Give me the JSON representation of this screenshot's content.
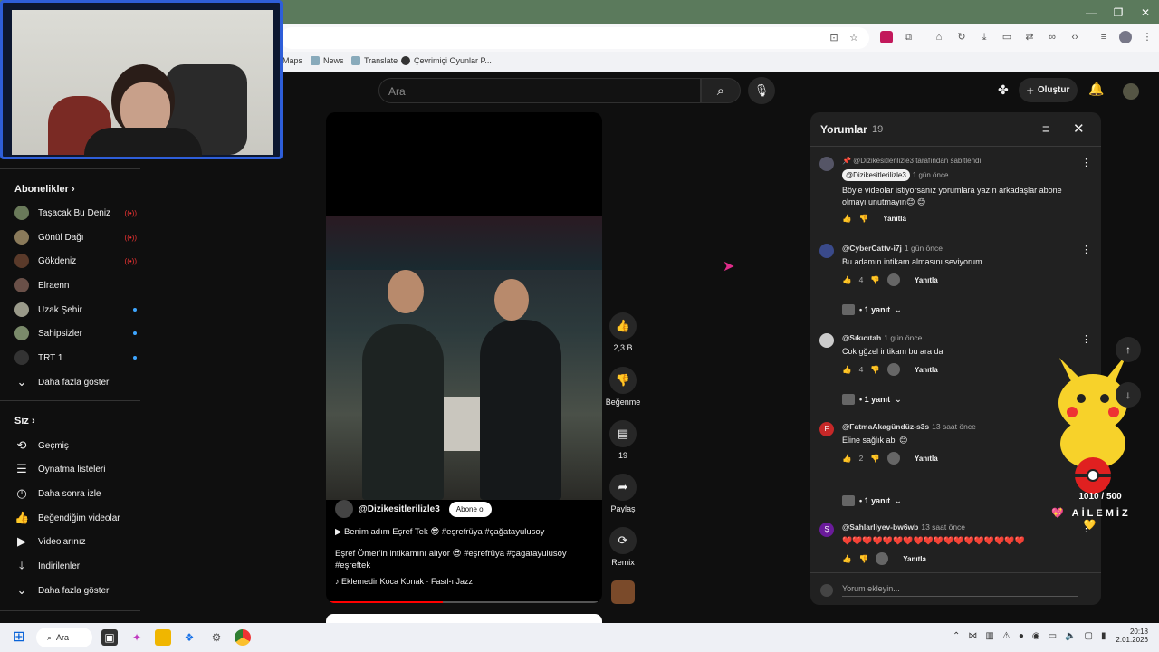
{
  "browser": {
    "bookmarks": [
      "Maps",
      "News",
      "Translate",
      "Çevrimiçi Oyunlar P..."
    ]
  },
  "header": {
    "search_placeholder": "Ara",
    "create_label": "Oluştur"
  },
  "sidebar": {
    "subscriptions_title": "Abonelikler",
    "subscriptions": [
      {
        "label": "Taşacak Bu Deniz",
        "badge": "live"
      },
      {
        "label": "Gönül Dağı",
        "badge": "live"
      },
      {
        "label": "Gökdeniz",
        "badge": "live"
      },
      {
        "label": "Elraenn",
        "badge": ""
      },
      {
        "label": "Uzak Şehir",
        "badge": "dot"
      },
      {
        "label": "Sahipsizler",
        "badge": "dot"
      },
      {
        "label": "TRT 1",
        "badge": "dot"
      }
    ],
    "show_more": "Daha fazla göster",
    "you_title": "Siz",
    "you_items": [
      {
        "label": "Geçmiş",
        "icon": "history-icon",
        "glyph": "⟲"
      },
      {
        "label": "Oynatma listeleri",
        "icon": "playlist-icon",
        "glyph": "☰"
      },
      {
        "label": "Daha sonra izle",
        "icon": "clock-icon",
        "glyph": "◷"
      },
      {
        "label": "Beğendiğim videolar",
        "icon": "thumb-up-icon",
        "glyph": "👍"
      },
      {
        "label": "Videolarınız",
        "icon": "video-icon",
        "glyph": "▶"
      },
      {
        "label": "İndirilenler",
        "icon": "download-icon",
        "glyph": "⤓"
      }
    ],
    "show_more_2": "Daha fazla göster"
  },
  "video": {
    "channel": "@Dizikesitlerilizle3",
    "subscribe_label": "Abone ol",
    "line1": "▶  Benim adım Eşref Tek 😎   #eşrefrüya #çağatayulusoy",
    "line2": "Eşref Ömer'in intikamını alıyor 😎 #eşrefrüya #çagatayulusoy #eşreftek",
    "music": "♪ Eklemedir Koca Konak · Fasıl-ı Jazz",
    "progress": 0.42
  },
  "actions": {
    "like_count": "2,3 B",
    "dislike_label": "Beğenme",
    "comment_count": "19",
    "share_label": "Paylaş",
    "remix_label": "Remix"
  },
  "comments": {
    "title": "Yorumlar",
    "count": "19",
    "items": [
      {
        "pinned": "📌 @Dizikesitlerilizle3 tarafından sabitlendi",
        "author": "@Dizikesitlerilizle3",
        "time": "1 gün önce",
        "text": "Böyle videolar istiyorsanız yorumlara yazın arkadaşlar abone olmayı unutmayın😊 😊",
        "likes": "",
        "reply_label": "Yanıtla"
      },
      {
        "author": "@CyberCattv-i7j",
        "time": "1 gün önce",
        "text": "Bu adamın intikam almasını seviyorum",
        "likes": "4",
        "reply_label": "Yanıtla",
        "replies": "• 1 yanıt"
      },
      {
        "author": "@Sıkıcıtah",
        "time": "1 gün önce",
        "text": "Cok gğzel intikam bu ara da",
        "likes": "4",
        "reply_label": "Yanıtla",
        "replies": "• 1 yanıt"
      },
      {
        "author": "@FatmaAkagündüz-s3s",
        "time": "13 saat önce",
        "text": "Eline sağlık abi 😊",
        "likes": "2",
        "reply_label": "Yanıtla",
        "replies": "• 1 yanıt",
        "avatar_letter": "F"
      },
      {
        "author": "@Sahlarliyev-bw6wb",
        "time": "13 saat önce",
        "text": "❤️❤️❤️❤️❤️❤️❤️❤️❤️❤️❤️❤️❤️❤️❤️❤️❤️❤️",
        "likes": "",
        "reply_label": "Yanıtla",
        "avatar_letter": "Ş"
      }
    ],
    "input_placeholder": "Yorum ekleyin..."
  },
  "overlay": {
    "counter": "1010 / 500",
    "family": "💖 AİLEMİZ 💛"
  },
  "taskbar": {
    "search_label": "Ara",
    "time": "20:18",
    "date": "2.01.2026"
  }
}
